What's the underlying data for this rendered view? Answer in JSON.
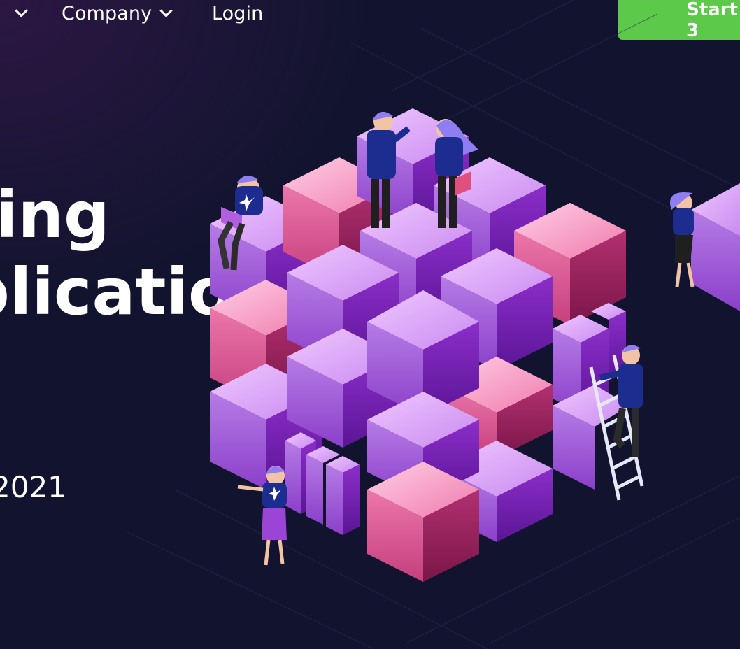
{
  "nav": {
    "items": [
      {
        "label": ""
      },
      {
        "label": "Company"
      },
      {
        "label": "Login"
      }
    ],
    "cta_label": "Start 3"
  },
  "hero": {
    "line1": "ing",
    "line2": "plication",
    "date_text": "2021"
  },
  "colors": {
    "background": "#12142f",
    "cta_green": "#5cc94a",
    "cube_purple": "#9b45d6",
    "cube_pink": "#e0507f",
    "shirt_blue": "#1d2c8f"
  },
  "icons": [
    "chevron-down-icon",
    "chevron-down-icon"
  ]
}
